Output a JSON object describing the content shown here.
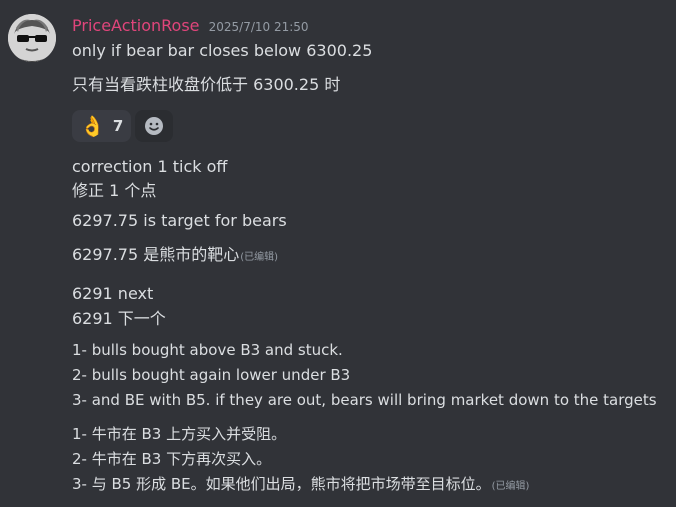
{
  "message": {
    "author": "PriceActionRose",
    "timestamp": "2025/7/10 21:50",
    "author_color": "#e0457b",
    "edited_label": "(已编辑)",
    "lines_top": [
      "only if bear bar closes below 6300.25",
      "只有当看跌柱收盘价低于 6300.25 时"
    ],
    "reactions": [
      {
        "emoji": "👌",
        "icon": "ok-hand-icon",
        "count": "7"
      }
    ],
    "add_reaction_icon": "smiley-add-reaction-icon",
    "lines_mid": [
      "correction 1 tick off",
      "修正 1 个点",
      "6297.75 is target for bears",
      "6297.75 是熊市的靶心",
      "6291 next",
      "6291 下一个",
      "1- bulls bought above B3 and stuck.",
      "2- bulls bought again lower under B3",
      "3- and BE with B5. if they are out, bears will bring market down to the targets",
      "1- 牛市在 B3 上方买入并受阻。",
      "2- 牛市在 B3 下方再次买入。",
      "3- 与 B5 形成 BE。如果他们出局，熊市将把市场带至目标位。"
    ]
  }
}
